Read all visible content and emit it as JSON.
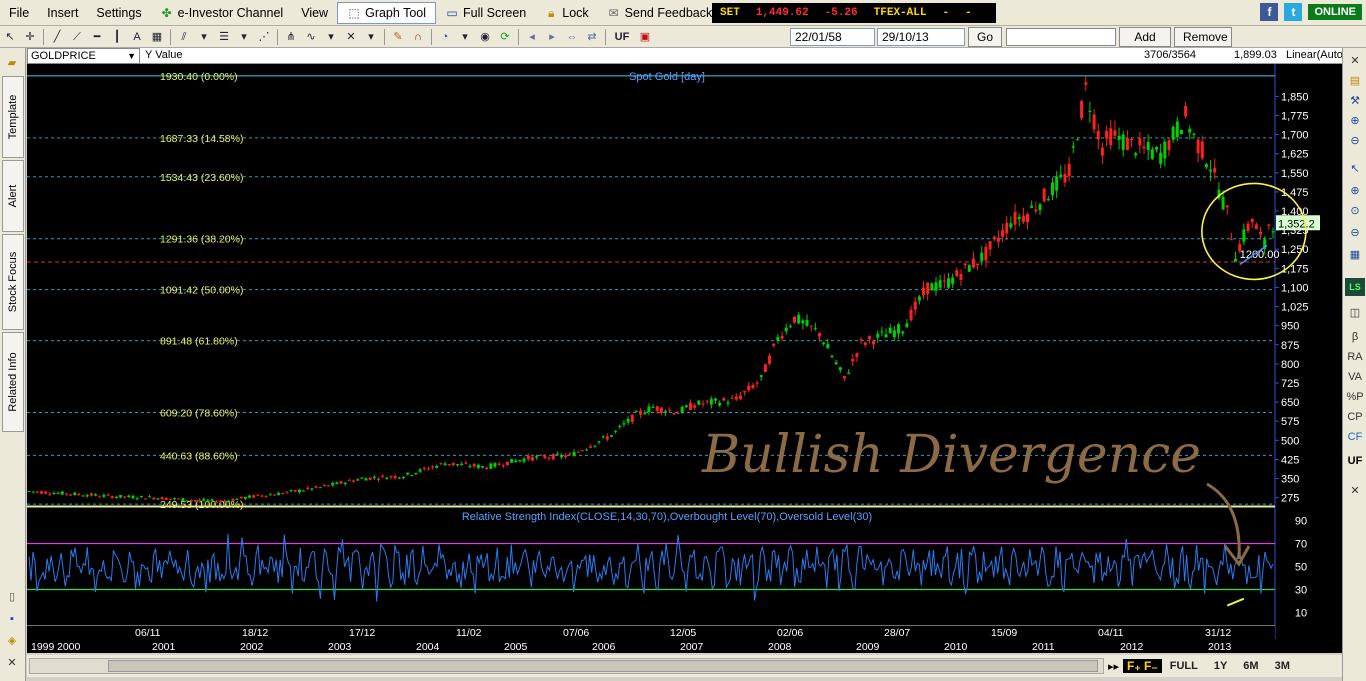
{
  "menu": {
    "file": "File",
    "insert": "Insert",
    "settings": "Settings",
    "einvestor": "e-Investor Channel",
    "view": "View",
    "graph_tool": "Graph Tool",
    "full_screen": "Full Screen",
    "lock": "Lock",
    "send_feedback": "Send Feedback"
  },
  "ticker": {
    "set_label": "SET",
    "set_value": "1,449.62",
    "set_change": "-5.26",
    "tfex_label": "TFEX-ALL",
    "dash1": "-",
    "dash2": "-"
  },
  "status": {
    "online": "ONLINE"
  },
  "toolbar": {
    "uf": "UF",
    "date_from": "22/01/58",
    "date_to": "29/10/13",
    "go": "Go",
    "add": "Add",
    "remove": "Remove"
  },
  "side_tabs": [
    "Template",
    "Alert",
    "Stock Focus",
    "Related Info"
  ],
  "right_icons": [
    "β",
    "RA",
    "VA",
    "%P",
    "CP",
    "CF",
    "UF"
  ],
  "series_bar": {
    "symbol": "GOLDPRICE",
    "y_label": "Y Value",
    "counter": "3706/3564",
    "value": "1,899.03",
    "scale": "Linear(Auto"
  },
  "chart_data": {
    "type": "line",
    "title": "Spot Gold [day]",
    "ylim": [
      250,
      1930
    ],
    "y_ticks": [
      275,
      350,
      425,
      500,
      575,
      650,
      725,
      800,
      875,
      950,
      1025,
      1100,
      1175,
      1250,
      1325,
      1400,
      1475,
      1550,
      1625,
      1700,
      1775,
      1850
    ],
    "y_tick_labels": [
      "275",
      "350",
      "425",
      "500",
      "575",
      "650",
      "725",
      "800",
      "875",
      "950",
      "1,025",
      "1,100",
      "1,175",
      "1,250",
      "1,325",
      "1,400",
      "1,475",
      "1,550",
      "1,625",
      "1,700",
      "1,775",
      "1,850"
    ],
    "fib_levels": [
      {
        "value": 1930.4,
        "label": "1930.40 (0.00%)"
      },
      {
        "value": 1687.33,
        "label": "1687.33 (14.58%)"
      },
      {
        "value": 1534.43,
        "label": "1534.43 (23.60%)"
      },
      {
        "value": 1291.36,
        "label": "1291.36 (38.20%)"
      },
      {
        "value": 1091.42,
        "label": "1091.42 (50.00%)"
      },
      {
        "value": 891.48,
        "label": "891.48 (61.80%)"
      },
      {
        "value": 609.2,
        "label": "609.20 (78.60%)"
      },
      {
        "value": 440.63,
        "label": "440.63 (88.60%)"
      },
      {
        "value": 249.53,
        "label": "249.53 (100.00%)"
      }
    ],
    "support_level": {
      "value": 1200,
      "label": "1200.00"
    },
    "last_price": "1,352.2",
    "price_path": [
      [
        1999.0,
        300
      ],
      [
        1999.5,
        290
      ],
      [
        2000.0,
        280
      ],
      [
        2000.5,
        275
      ],
      [
        2001.0,
        265
      ],
      [
        2001.3,
        260
      ],
      [
        2001.7,
        280
      ],
      [
        2002.0,
        290
      ],
      [
        2002.5,
        315
      ],
      [
        2003.0,
        350
      ],
      [
        2003.5,
        360
      ],
      [
        2004.0,
        410
      ],
      [
        2004.5,
        395
      ],
      [
        2005.0,
        430
      ],
      [
        2005.5,
        440
      ],
      [
        2006.0,
        520
      ],
      [
        2006.3,
        600
      ],
      [
        2006.5,
        630
      ],
      [
        2006.8,
        610
      ],
      [
        2007.0,
        640
      ],
      [
        2007.5,
        660
      ],
      [
        2007.8,
        740
      ],
      [
        2008.0,
        900
      ],
      [
        2008.2,
        980
      ],
      [
        2008.5,
        920
      ],
      [
        2008.8,
        740
      ],
      [
        2009.0,
        880
      ],
      [
        2009.5,
        940
      ],
      [
        2009.8,
        1100
      ],
      [
        2010.0,
        1110
      ],
      [
        2010.5,
        1230
      ],
      [
        2010.8,
        1360
      ],
      [
        2011.0,
        1390
      ],
      [
        2011.5,
        1550
      ],
      [
        2011.7,
        1880
      ],
      [
        2011.9,
        1650
      ],
      [
        2012.0,
        1700
      ],
      [
        2012.3,
        1650
      ],
      [
        2012.6,
        1620
      ],
      [
        2012.9,
        1770
      ],
      [
        2013.0,
        1690
      ],
      [
        2013.2,
        1580
      ],
      [
        2013.4,
        1390
      ],
      [
        2013.5,
        1230
      ],
      [
        2013.7,
        1370
      ],
      [
        2013.85,
        1260
      ],
      [
        2013.9,
        1352
      ]
    ],
    "x_range": [
      1999,
      2013.95
    ],
    "date_labels": [
      "06/11",
      "18/12",
      "17/12",
      "11/02",
      "07/06",
      "12/05",
      "02/06",
      "28/07",
      "15/09",
      "04/11",
      "31/12"
    ],
    "year_labels": [
      "1999",
      "2000",
      "2001",
      "2002",
      "2003",
      "2004",
      "2005",
      "2006",
      "2007",
      "2008",
      "2009",
      "2010",
      "2011",
      "2012",
      "2013"
    ],
    "annotation": "Bullish Divergence",
    "rsi": {
      "title": "Relative Strength Index(CLOSE,14,30,70),Overbought Level(70),Oversold Level(30)",
      "ylim": [
        0,
        100
      ],
      "overbought": 70,
      "oversold": 30,
      "y_ticks": [
        10,
        30,
        50,
        70,
        90
      ]
    }
  },
  "range_buttons": [
    "FULL",
    "1Y",
    "6M",
    "3M"
  ],
  "colors": {
    "up": "#00d000",
    "down": "#ff2020",
    "fib": "#20a0c0",
    "support": "#e03030",
    "rsi": "#2a7cf0",
    "annotation": "#8b6a45",
    "circle": "#fff24a"
  }
}
